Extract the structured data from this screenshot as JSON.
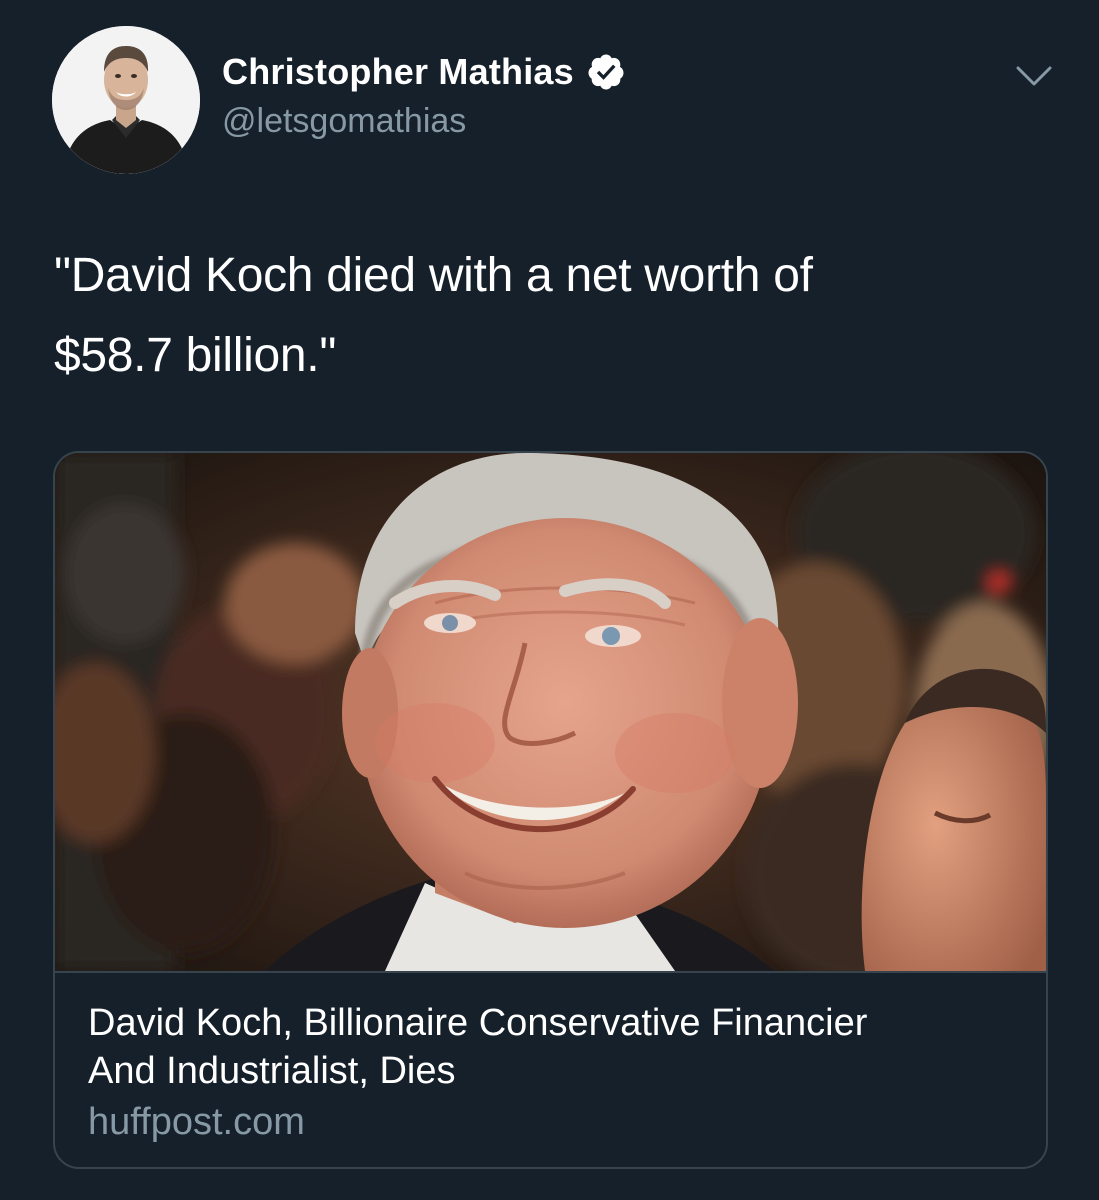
{
  "tweet": {
    "author": {
      "display_name": "Christopher Mathias",
      "handle": "@letsgomathias",
      "verified": true
    },
    "text_line1": "\"David Koch died with a net worth of",
    "text_line2": "$58.7 billion.\"",
    "card": {
      "title_line1": "David Koch, Billionaire Conservative Financier",
      "title_line2": "And Industrialist, Dies",
      "domain": "huffpost.com"
    }
  },
  "icons": {
    "verified": "verified-badge-icon",
    "menu": "chevron-down-icon"
  },
  "colors": {
    "background": "#15202b",
    "secondary_text": "#8899a6",
    "border": "#38444d",
    "verified_fill": "#ffffff"
  }
}
